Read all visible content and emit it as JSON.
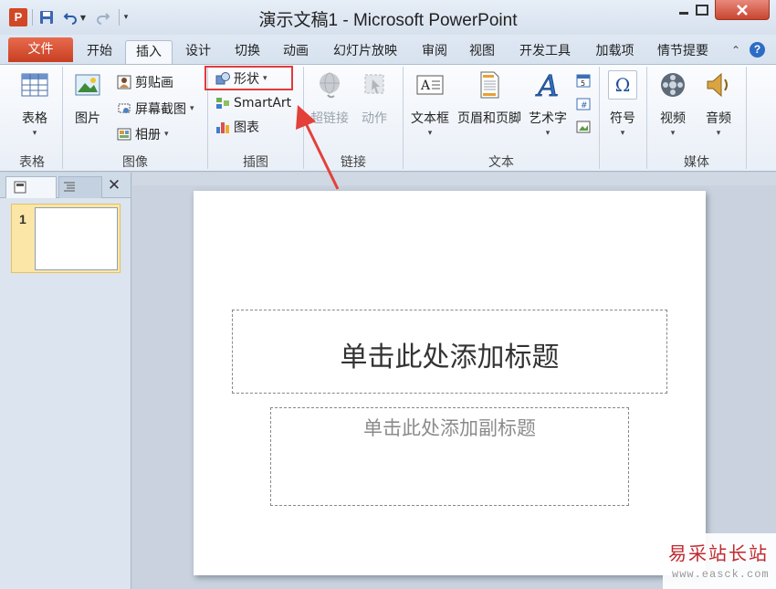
{
  "window": {
    "app_icon_letter": "P",
    "title": "演示文稿1 - Microsoft PowerPoint"
  },
  "tabs": {
    "file": "文件",
    "items": [
      "开始",
      "插入",
      "设计",
      "切换",
      "动画",
      "幻灯片放映",
      "审阅",
      "视图",
      "开发工具",
      "加载项",
      "情节提要"
    ],
    "active": "插入"
  },
  "ribbon": {
    "groups": {
      "table": "表格",
      "images": "图像",
      "illustrations": "插图",
      "links": "链接",
      "text": "文本",
      "media": "媒体"
    },
    "buttons": {
      "table": "表格",
      "picture": "图片",
      "clipart": "剪贴画",
      "screenshot": "屏幕截图",
      "album": "相册",
      "shapes": "形状",
      "smartart": "SmartArt",
      "chart": "图表",
      "hyperlink": "超链接",
      "action": "动作",
      "textbox": "文本框",
      "header_footer": "页眉和页脚",
      "wordart": "艺术字",
      "symbol": "符号",
      "video": "视频",
      "audio": "音频"
    }
  },
  "slides_pane": {
    "slide_number": "1"
  },
  "slide": {
    "title_placeholder": "单击此处添加标题",
    "subtitle_placeholder": "单击此处添加副标题"
  },
  "watermark": {
    "logo": "易采站长站",
    "url": "www.easck.com"
  },
  "colors": {
    "accent_file_tab": "#c83f22",
    "highlight": "#e23b3b"
  }
}
